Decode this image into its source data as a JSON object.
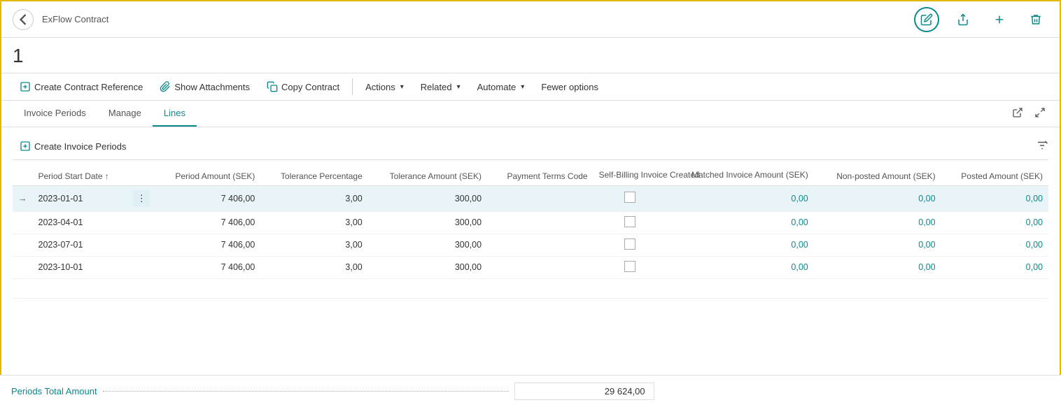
{
  "app": {
    "title": "ExFlow Contract",
    "record_id": "1"
  },
  "top_actions": {
    "edit_label": "Edit",
    "share_label": "Share",
    "add_label": "Add",
    "delete_label": "Delete"
  },
  "action_bar": {
    "create_contract_reference": "Create Contract Reference",
    "show_attachments": "Show Attachments",
    "copy_contract": "Copy Contract",
    "actions": "Actions",
    "related": "Related",
    "automate": "Automate",
    "fewer_options": "Fewer options"
  },
  "tabs": {
    "invoice_periods": "Invoice Periods",
    "manage": "Manage",
    "lines": "Lines"
  },
  "sub_actions": {
    "create_invoice_periods": "Create Invoice Periods"
  },
  "table": {
    "columns": [
      {
        "key": "period_start_date",
        "label": "Period Start Date ↑",
        "align": "left"
      },
      {
        "key": "context",
        "label": "",
        "align": "center"
      },
      {
        "key": "period_amount",
        "label": "Period Amount (SEK)",
        "align": "right"
      },
      {
        "key": "tolerance_percentage",
        "label": "Tolerance Percentage",
        "align": "right"
      },
      {
        "key": "tolerance_amount",
        "label": "Tolerance Amount (SEK)",
        "align": "right"
      },
      {
        "key": "payment_terms_code",
        "label": "Payment Terms Code",
        "align": "right"
      },
      {
        "key": "self_billing_invoice_created",
        "label": "Self-Billing Invoice Created",
        "align": "center"
      },
      {
        "key": "matched_invoice_amount",
        "label": "Matched Invoice Amount (SEK)",
        "align": "right"
      },
      {
        "key": "non_posted_amount",
        "label": "Non-posted Amount (SEK)",
        "align": "right"
      },
      {
        "key": "posted_amount",
        "label": "Posted Amount (SEK)",
        "align": "right"
      }
    ],
    "rows": [
      {
        "period_start_date": "2023-01-01",
        "period_amount": "7 406,00",
        "tolerance_percentage": "3,00",
        "tolerance_amount": "300,00",
        "payment_terms_code": "",
        "self_billing": false,
        "matched_invoice_amount": "0,00",
        "non_posted_amount": "0,00",
        "posted_amount": "0,00",
        "active": true
      },
      {
        "period_start_date": "2023-04-01",
        "period_amount": "7 406,00",
        "tolerance_percentage": "3,00",
        "tolerance_amount": "300,00",
        "payment_terms_code": "",
        "self_billing": false,
        "matched_invoice_amount": "0,00",
        "non_posted_amount": "0,00",
        "posted_amount": "0,00",
        "active": false
      },
      {
        "period_start_date": "2023-07-01",
        "period_amount": "7 406,00",
        "tolerance_percentage": "3,00",
        "tolerance_amount": "300,00",
        "payment_terms_code": "",
        "self_billing": false,
        "matched_invoice_amount": "0,00",
        "non_posted_amount": "0,00",
        "posted_amount": "0,00",
        "active": false
      },
      {
        "period_start_date": "2023-10-01",
        "period_amount": "7 406,00",
        "tolerance_percentage": "3,00",
        "tolerance_amount": "300,00",
        "payment_terms_code": "",
        "self_billing": false,
        "matched_invoice_amount": "0,00",
        "non_posted_amount": "0,00",
        "posted_amount": "0,00",
        "active": false
      }
    ]
  },
  "totals": {
    "label": "Periods Total Amount",
    "value": "29 624,00"
  }
}
